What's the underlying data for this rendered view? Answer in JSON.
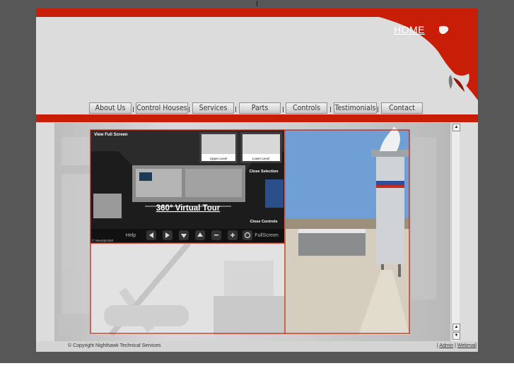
{
  "header": {
    "home_label": "HOME"
  },
  "nav": {
    "items": [
      {
        "label": "About Us"
      },
      {
        "label": "Control Houses"
      },
      {
        "label": "Services"
      },
      {
        "label": "Parts"
      },
      {
        "label": "Controls"
      },
      {
        "label": "Testimonials"
      },
      {
        "label": "Contact"
      }
    ],
    "separator": "|"
  },
  "tour": {
    "view_full_screen": "View Full Screen",
    "upper_level": "Upper Level",
    "lower_level": "Lower Level",
    "close_selection": "Close Selection",
    "title": "360° Virtual Tour",
    "close_controls": "Close Controls",
    "help": "Help",
    "fullscreen": "FullScreen",
    "credit": "© NewSpin360",
    "controls": [
      "left-arrow-icon",
      "right-arrow-icon",
      "down-arrow-icon",
      "up-arrow-icon",
      "zoom-out-icon",
      "zoom-in-icon",
      "rotate-icon"
    ]
  },
  "footer": {
    "copyright": "© Copyright Nighthawk Technical Services",
    "admin": "Admin",
    "sep": "|",
    "webmail": "Webmail"
  },
  "colors": {
    "brand_red": "#c81d06",
    "page_bg": "#575757",
    "panel_bg": "#dcdcdc"
  }
}
